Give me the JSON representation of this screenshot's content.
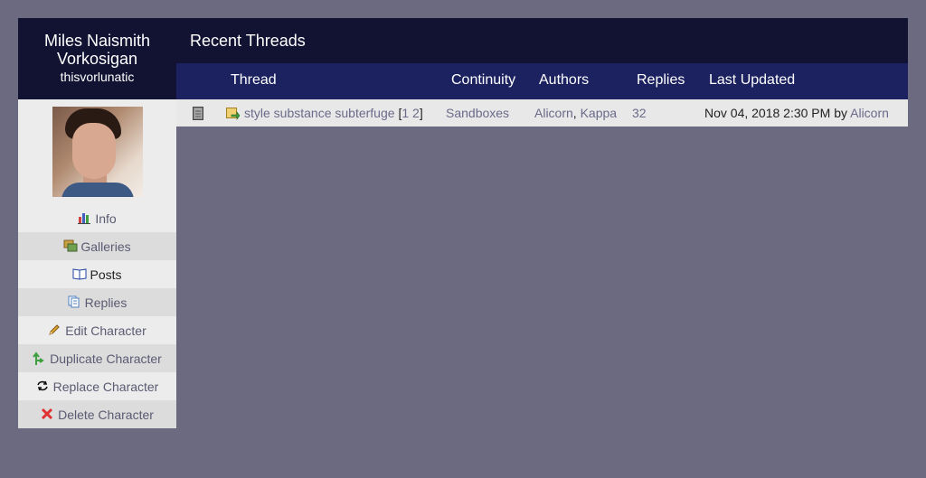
{
  "character": {
    "name": "Miles Naismith Vorkosigan",
    "screenname": "thisvorlunatic"
  },
  "menu": [
    {
      "label": "Info",
      "icon": "chart-bar-icon"
    },
    {
      "label": "Galleries",
      "icon": "images-icon"
    },
    {
      "label": "Posts",
      "icon": "open-book-icon"
    },
    {
      "label": "Replies",
      "icon": "documents-icon"
    },
    {
      "label": "Edit Character",
      "icon": "pencil-icon"
    },
    {
      "label": "Duplicate Character",
      "icon": "split-arrow-icon"
    },
    {
      "label": "Replace Character",
      "icon": "refresh-icon"
    },
    {
      "label": "Delete Character",
      "icon": "red-x-icon"
    }
  ],
  "threads": {
    "title": "Recent Threads",
    "columns": {
      "thread": "Thread",
      "continuity": "Continuity",
      "authors": "Authors",
      "replies": "Replies",
      "last_updated": "Last Updated"
    },
    "rows": [
      {
        "title": "style substance subterfuge",
        "pages": [
          "1",
          "2"
        ],
        "continuity": "Sandboxes",
        "authors": [
          "Alicorn",
          "Kappa"
        ],
        "replies": "32",
        "last_updated": "Nov 04, 2018 2:30 PM",
        "by_word": "by",
        "last_author": "Alicorn"
      }
    ]
  }
}
